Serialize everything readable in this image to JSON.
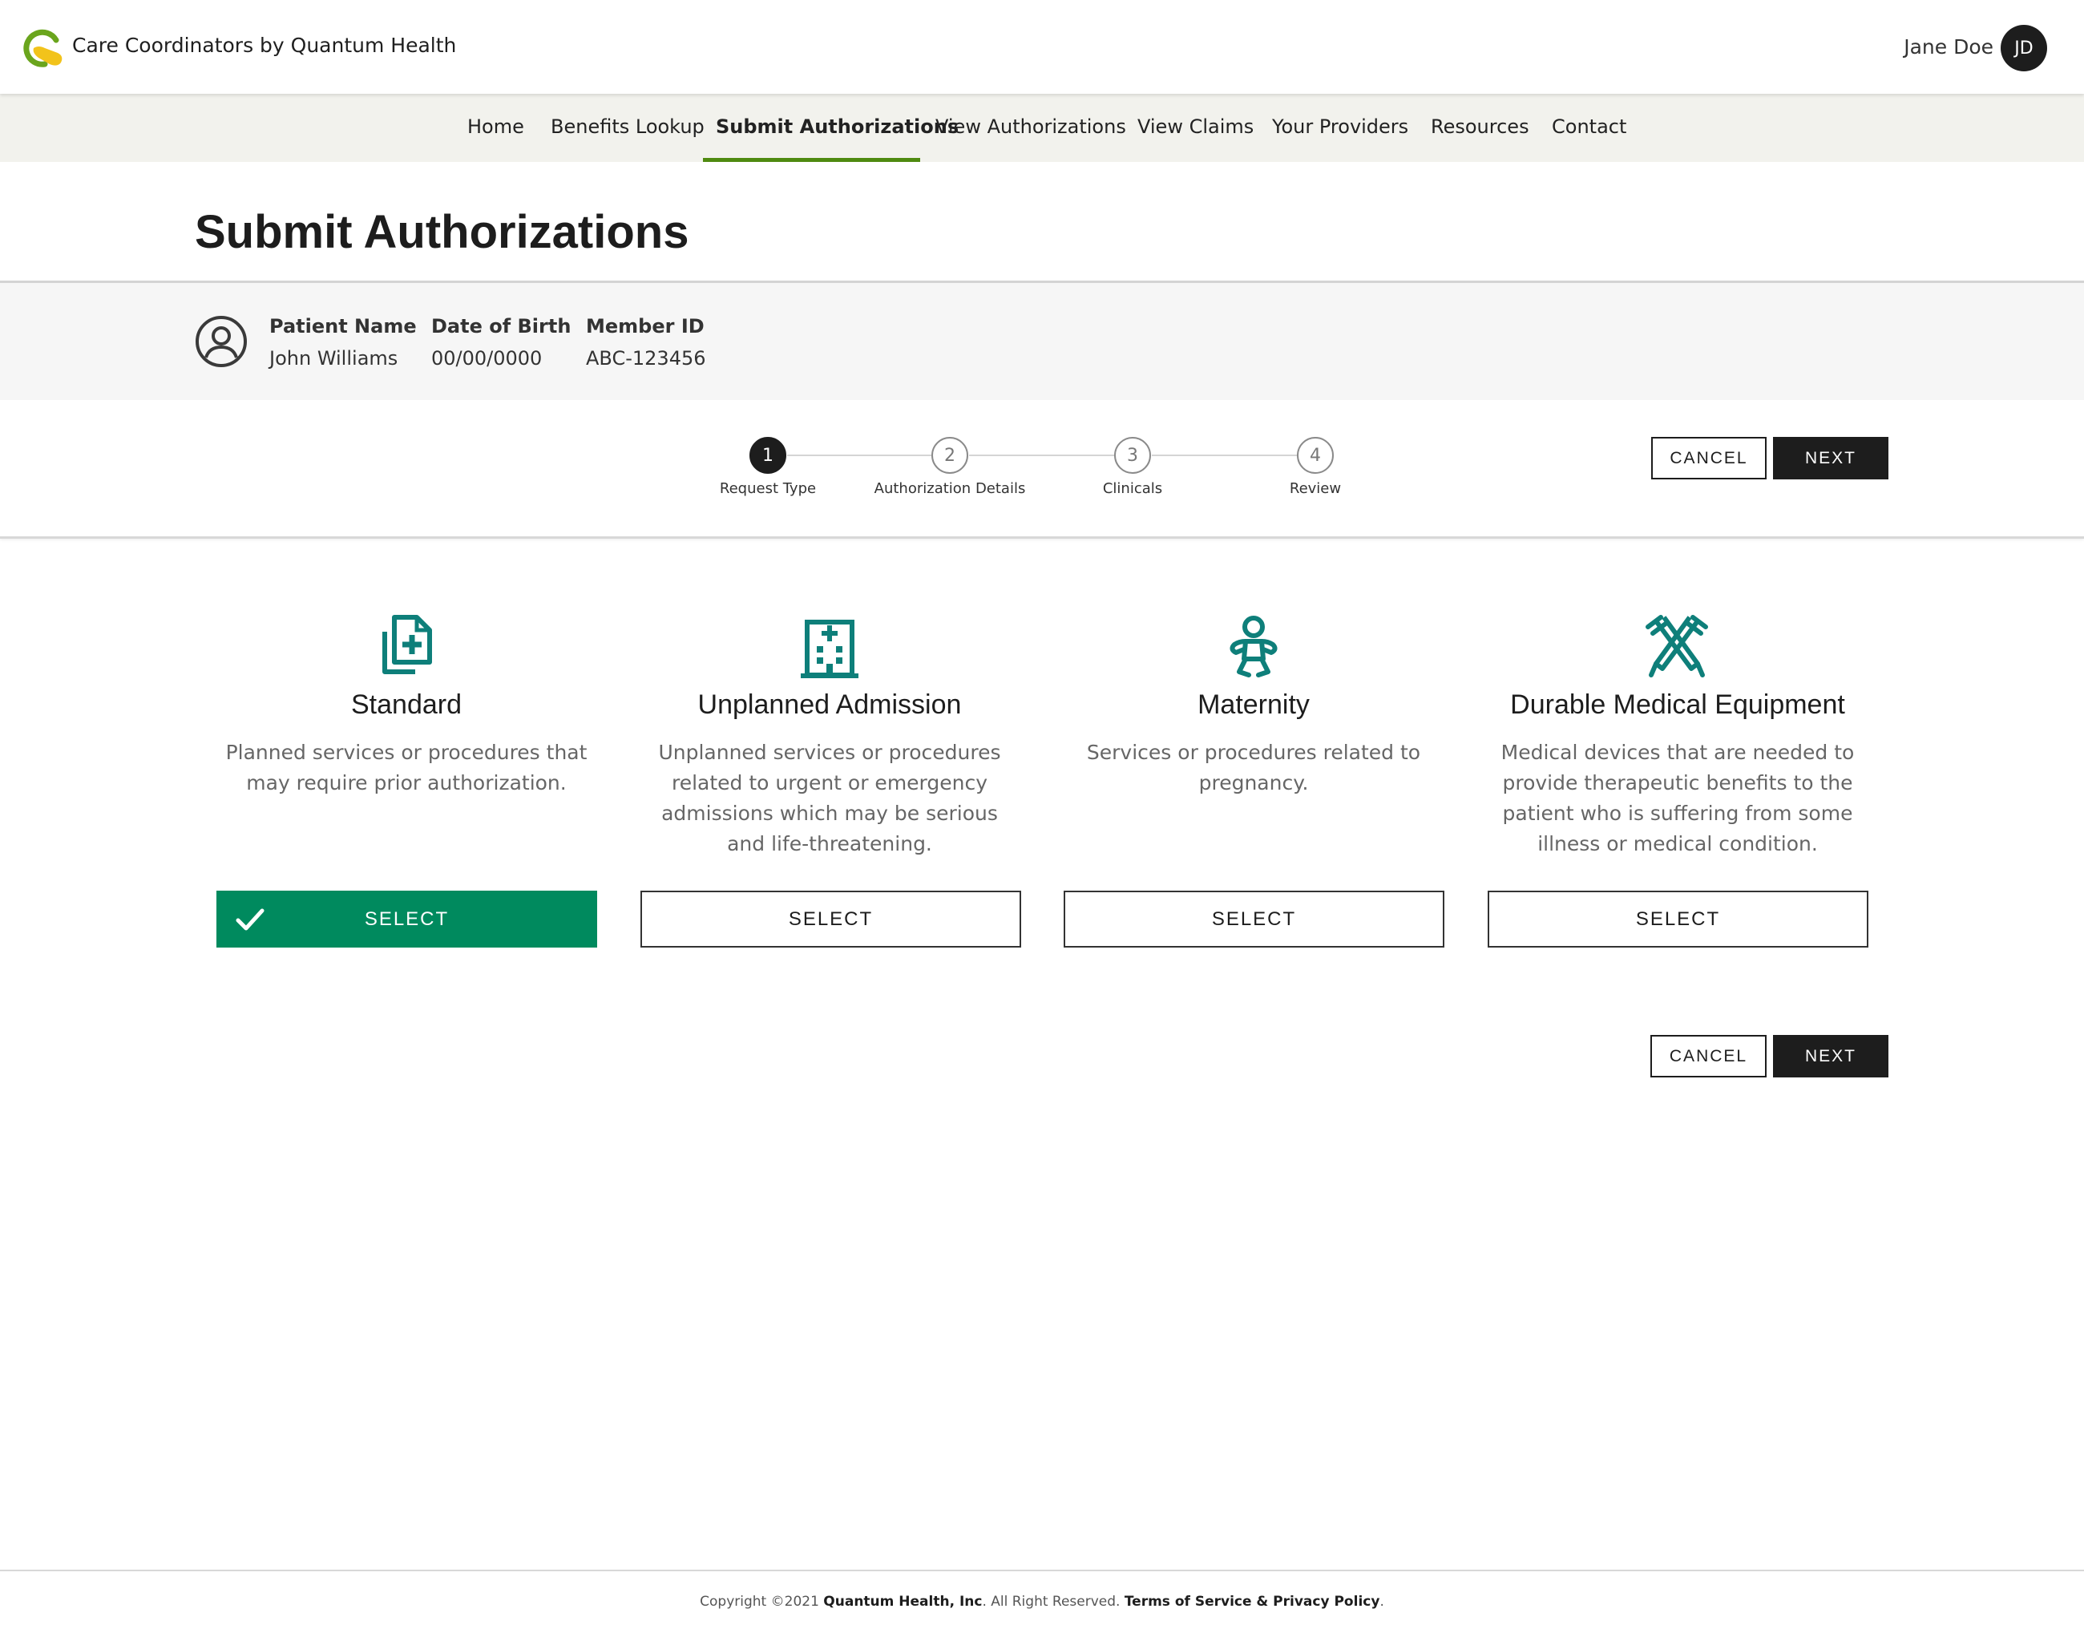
{
  "header": {
    "brand": "Care Coordinators by Quantum Health",
    "user_name": "Jane Doe",
    "user_initials": "JD"
  },
  "nav": {
    "items": [
      {
        "label": "Home",
        "active": false
      },
      {
        "label": "Benefits Lookup",
        "active": false
      },
      {
        "label": "Submit Authorizations",
        "active": true
      },
      {
        "label": "View Authorizations",
        "active": false
      },
      {
        "label": "View Claims",
        "active": false
      },
      {
        "label": "Your Providers",
        "active": false
      },
      {
        "label": "Resources",
        "active": false
      },
      {
        "label": "Contact",
        "active": false
      }
    ]
  },
  "page": {
    "title": "Submit Authorizations"
  },
  "patient": {
    "name_label": "Patient Name",
    "name_value": "John Williams",
    "dob_label": "Date of Birth",
    "dob_value": "00/00/0000",
    "member_label": "Member ID",
    "member_value": "ABC-123456"
  },
  "stepper": {
    "current_step": 1,
    "steps": [
      {
        "number": "1",
        "label": "Request Type"
      },
      {
        "number": "2",
        "label": "Authorization Details"
      },
      {
        "number": "3",
        "label": "Clinicals"
      },
      {
        "number": "4",
        "label": "Review"
      }
    ]
  },
  "actions": {
    "cancel_label": "CANCEL",
    "next_label": "NEXT"
  },
  "request_types": [
    {
      "icon": "document-plus-icon",
      "title": "Standard",
      "description": "Planned services or procedures that may require prior authorization.",
      "button_label": "SELECT",
      "selected": true
    },
    {
      "icon": "hospital-icon",
      "title": "Unplanned Admission",
      "description": "Unplanned services or procedures related to urgent or emergency admissions which may be serious and life-threatening.",
      "button_label": "SELECT",
      "selected": false
    },
    {
      "icon": "baby-icon",
      "title": "Maternity",
      "description": "Services or procedures related to pregnancy.",
      "button_label": "SELECT",
      "selected": false
    },
    {
      "icon": "crutches-icon",
      "title": "Durable Medical Equipment",
      "description": "Medical devices that are needed to provide therapeutic benefits to the patient who is suffering from some illness or medical condition.",
      "button_label": "SELECT",
      "selected": false
    }
  ],
  "footer": {
    "prefix": "Copyright ©2021 ",
    "company": "Quantum Health, Inc",
    "middle": ". All Right Reserved. ",
    "terms_link": "Terms of Service & Privacy Policy",
    "suffix": "."
  },
  "colors": {
    "accent_green": "#4f8a10",
    "selected_green": "#008a5e",
    "icon_teal": "#0e7f7a",
    "dark": "#1d1d1d"
  }
}
